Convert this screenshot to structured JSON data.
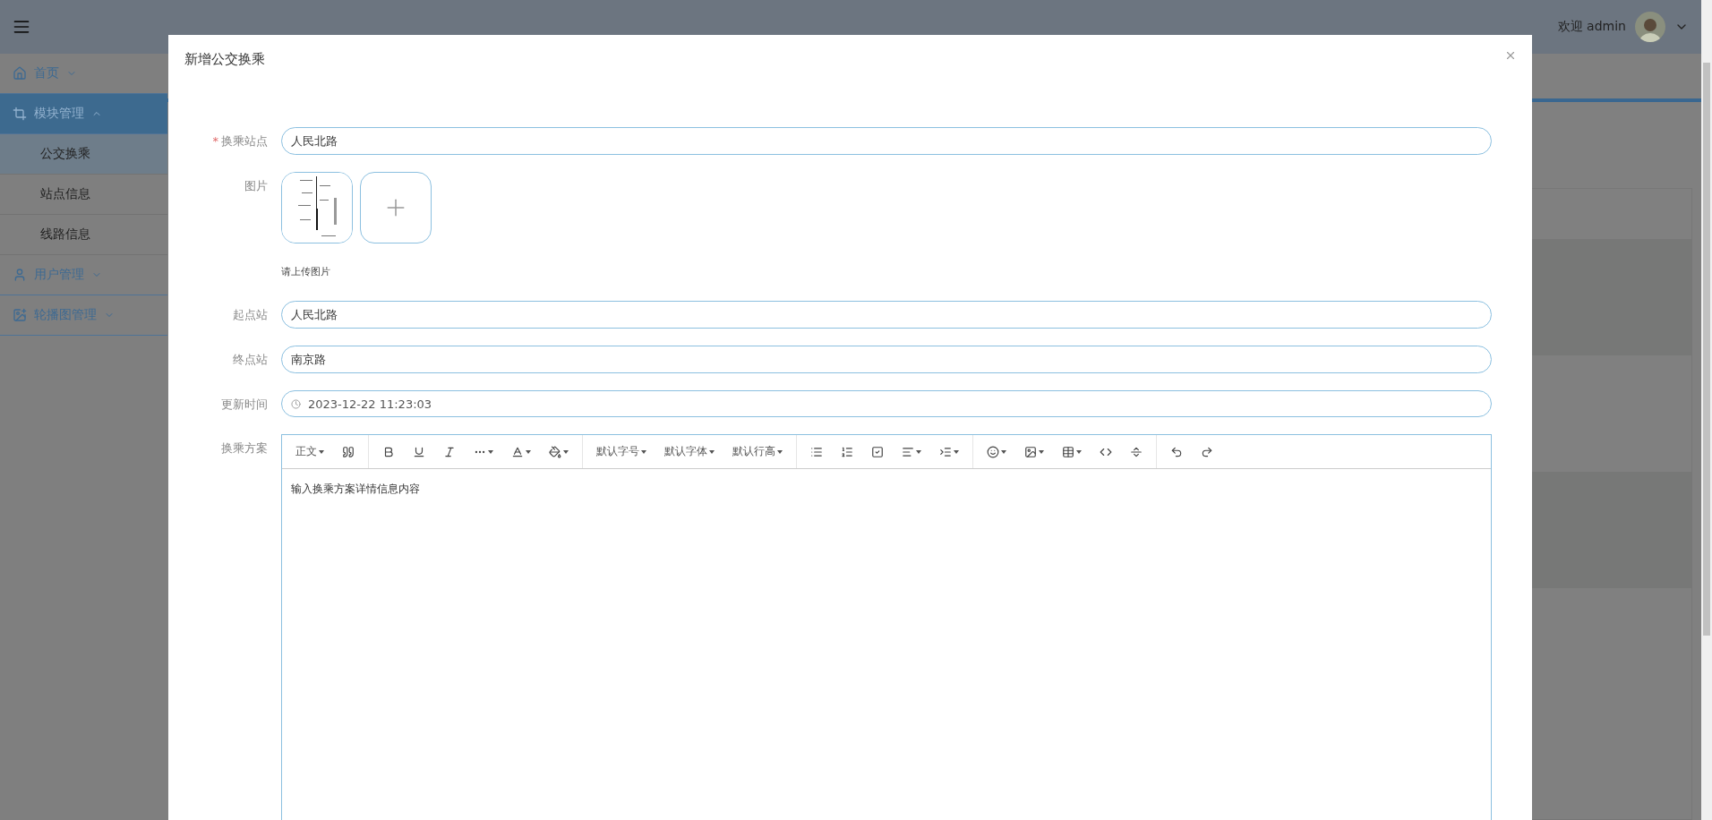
{
  "header": {
    "welcome": "欢迎 admin"
  },
  "sidebar": {
    "items": [
      {
        "label": "首页",
        "expanded": false,
        "selected": false
      },
      {
        "label": "模块管理",
        "expanded": true,
        "selected": true,
        "children": [
          {
            "label": "公交换乘",
            "selected": true
          },
          {
            "label": "站点信息",
            "selected": false
          },
          {
            "label": "线路信息",
            "selected": false
          }
        ]
      },
      {
        "label": "用户管理",
        "expanded": false,
        "selected": false
      },
      {
        "label": "轮播图管理",
        "expanded": false,
        "selected": false
      }
    ]
  },
  "dialog": {
    "title": "新增公交换乘",
    "fields": [
      {
        "kind": "text",
        "label": "换乘站点",
        "required_mark": "*",
        "value": "人民北路"
      },
      {
        "kind": "upload",
        "label": "图片",
        "hint": "请上传图片"
      },
      {
        "kind": "text",
        "label": "起点站",
        "value": "人民北路"
      },
      {
        "kind": "text",
        "label": "终点站",
        "value": "南京路"
      },
      {
        "kind": "datetime",
        "label": "更新时间",
        "value": "2023-12-22 11:23:03"
      },
      {
        "kind": "editor",
        "label": "换乘方案",
        "value": "输入换乘方案详情信息内容",
        "toolbar": [
          [
            {
              "kind": "text",
              "label": "正文",
              "caret": true
            },
            {
              "kind": "icon",
              "caret": false
            }
          ],
          [
            {
              "kind": "icon",
              "caret": false
            },
            {
              "kind": "icon",
              "caret": false
            },
            {
              "kind": "icon",
              "caret": false
            },
            {
              "kind": "icon",
              "caret": true
            },
            {
              "kind": "icon",
              "caret": true
            },
            {
              "kind": "icon",
              "caret": true
            }
          ],
          [
            {
              "kind": "text",
              "label": "默认字号",
              "caret": true
            },
            {
              "kind": "text",
              "label": "默认字体",
              "caret": true
            },
            {
              "kind": "text",
              "label": "默认行高",
              "caret": true
            }
          ],
          [
            {
              "kind": "icon",
              "caret": false
            },
            {
              "kind": "icon",
              "caret": false
            },
            {
              "kind": "icon",
              "caret": false
            },
            {
              "kind": "icon",
              "caret": true
            },
            {
              "kind": "icon",
              "caret": true
            }
          ],
          [
            {
              "kind": "icon",
              "caret": true
            },
            {
              "kind": "icon",
              "caret": true
            },
            {
              "kind": "icon",
              "caret": true
            },
            {
              "kind": "icon",
              "caret": false
            },
            {
              "kind": "icon",
              "caret": false
            }
          ],
          [
            {
              "kind": "icon",
              "caret": false
            },
            {
              "kind": "icon",
              "caret": false
            }
          ]
        ]
      }
    ]
  }
}
